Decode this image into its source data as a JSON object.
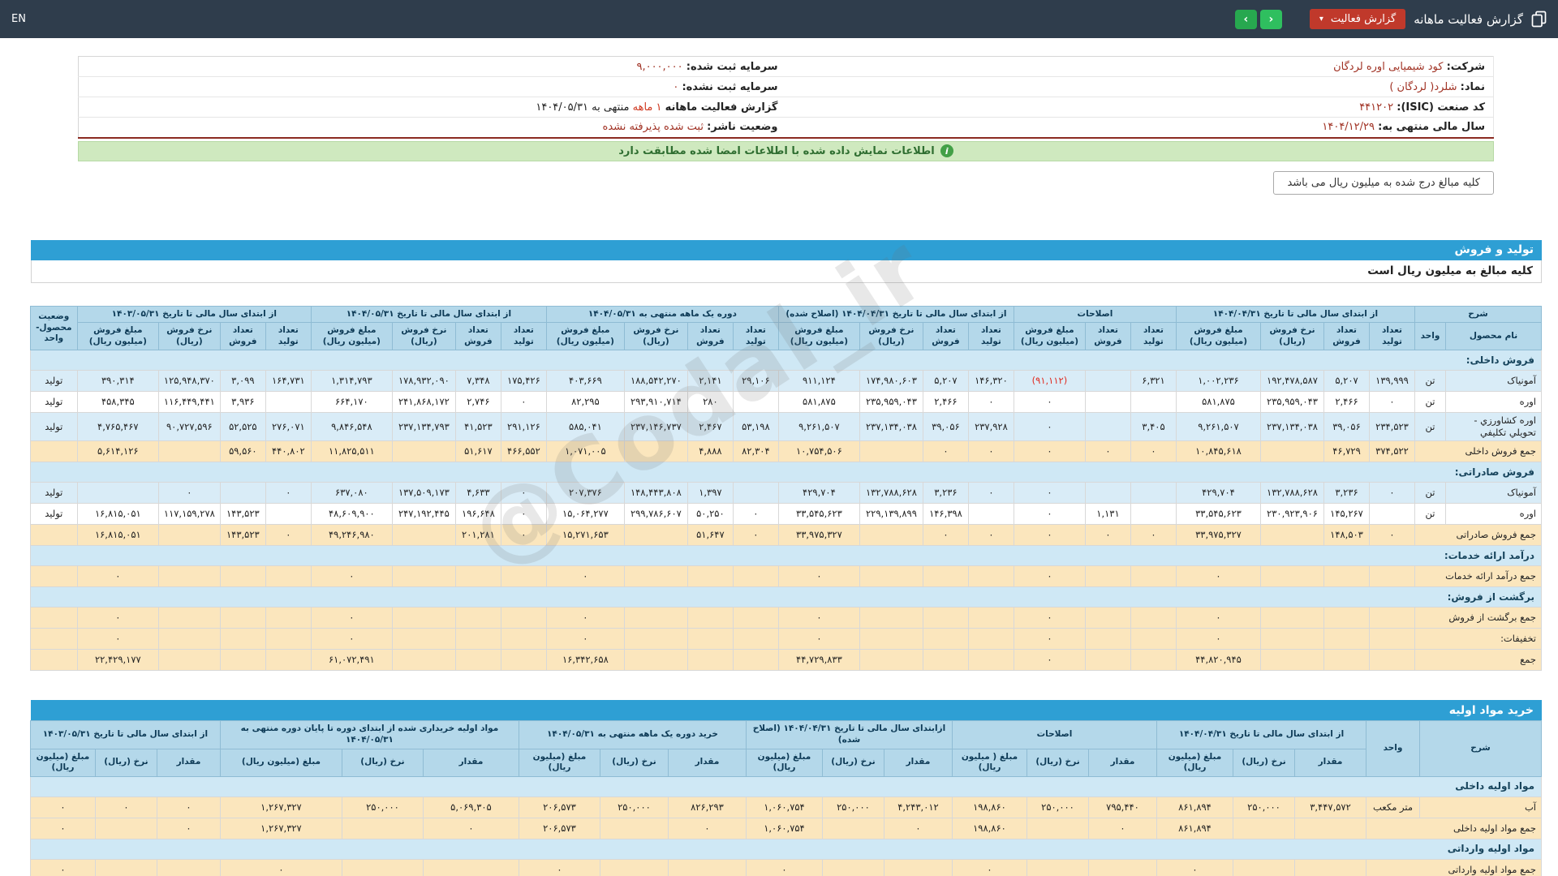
{
  "topbar": {
    "en": "EN",
    "title": "گزارش فعالیت ماهانه",
    "report_button": "گزارش فعالیت",
    "caret": "▾",
    "next": "›",
    "prev": "‹"
  },
  "info": {
    "rows": [
      {
        "r_label": "شرکت:",
        "r_value": "کود شیمیایی اوره لردگان",
        "l_label": "سرمایه ثبت شده:",
        "l_value": "۹,۰۰۰,۰۰۰"
      },
      {
        "r_label": "نماد:",
        "r_value": "شلرد( لردگان )",
        "l_label": "سرمایه ثبت نشده:",
        "l_value": "۰"
      },
      {
        "r_label": "کد صنعت (ISIC):",
        "r_value": "۴۴۱۲۰۲",
        "l_label": "گزارش فعالیت ماهانه",
        "l_red": "۱ ماهه",
        "l_value": "منتهی به ۱۴۰۴/۰۵/۳۱"
      },
      {
        "r_label": "سال مالی منتهی به:",
        "r_value": "۱۴۰۴/۱۲/۲۹",
        "l_label": "وضعیت ناشر:",
        "l_value": "ثبت شده پذیرفته نشده"
      }
    ]
  },
  "notice": "اطلاعات نمایش داده شده با اطلاعات امضا شده مطابقت دارد",
  "unit_tab": "کلیه مبالغ درج شده به میلیون ریال می باشد",
  "section1": {
    "title": "تولید و فروش",
    "subtitle": "کلیه مبالغ به میلیون ریال است"
  },
  "section2": {
    "title": "خرید مواد اولیه"
  },
  "watermark": "@Codal_ir",
  "table1": {
    "desc_header": "شرح",
    "name_col": "نام محصول",
    "unit_col": "واحد",
    "status_header": "وضعیت محصول-واحد",
    "groups": [
      {
        "label": "از ابتدای سال مالی تا تاریخ ۱۴۰۴/۰۴/۳۱",
        "cols": [
          "تعداد تولید",
          "تعداد فروش",
          "نرخ فروش (ریال)",
          "مبلغ فروش (میلیون ریال)"
        ]
      },
      {
        "label": "اصلاحات",
        "cols": [
          "تعداد تولید",
          "تعداد فروش",
          "مبلغ فروش (میلیون ریال)"
        ]
      },
      {
        "label": "از ابتدای سال مالی تا تاریخ ۱۴۰۴/۰۴/۳۱ (اصلاح شده)",
        "cols": [
          "تعداد تولید",
          "تعداد فروش",
          "نرخ فروش (ریال)",
          "مبلغ فروش (میلیون ریال)"
        ]
      },
      {
        "label": "دوره یک ماهه منتهی به ۱۴۰۴/۰۵/۳۱",
        "cols": [
          "تعداد تولید",
          "تعداد فروش",
          "نرخ فروش (ریال)",
          "مبلغ فروش (میلیون ریال)"
        ]
      },
      {
        "label": "از ابتدای سال مالی تا تاریخ ۱۴۰۴/۰۵/۳۱",
        "cols": [
          "تعداد تولید",
          "تعداد فروش",
          "نرخ فروش (ریال)",
          "مبلغ فروش (میلیون ریال)"
        ]
      },
      {
        "label": "از ابتدای سال مالی تا تاریخ ۱۴۰۳/۰۵/۳۱",
        "cols": [
          "تعداد تولید",
          "تعداد فروش",
          "نرخ فروش (ریال)",
          "مبلغ فروش (میلیون ریال)"
        ]
      }
    ],
    "rows": [
      {
        "kind": "section",
        "label": "فروش داخلی:"
      },
      {
        "kind": "data",
        "shade": "blue",
        "label": "آمونیاک",
        "unit": "تن",
        "status": "تولید",
        "c": [
          "۱۳۹,۹۹۹",
          "۵,۲۰۷",
          "۱۹۲,۴۷۸,۵۸۷",
          "۱,۰۰۲,۲۳۶",
          "۶,۳۲۱",
          "",
          "(۹۱,۱۱۲)",
          "۱۴۶,۳۲۰",
          "۵,۲۰۷",
          "۱۷۴,۹۸۰,۶۰۳",
          "۹۱۱,۱۲۴",
          "۲۹,۱۰۶",
          "۲,۱۴۱",
          "۱۸۸,۵۴۲,۲۷۰",
          "۴۰۳,۶۶۹",
          "۱۷۵,۴۲۶",
          "۷,۳۴۸",
          "۱۷۸,۹۳۲,۰۹۰",
          "۱,۳۱۴,۷۹۳",
          "۱۶۴,۷۳۱",
          "۳,۰۹۹",
          "۱۲۵,۹۴۸,۳۷۰",
          "۳۹۰,۳۱۴"
        ]
      },
      {
        "kind": "data",
        "shade": "white",
        "label": "اوره",
        "unit": "تن",
        "status": "تولید",
        "c": [
          "۰",
          "۲,۴۶۶",
          "۲۳۵,۹۵۹,۰۴۳",
          "۵۸۱,۸۷۵",
          "",
          "",
          "۰",
          "۰",
          "۲,۴۶۶",
          "۲۳۵,۹۵۹,۰۴۳",
          "۵۸۱,۸۷۵",
          "",
          "۲۸۰",
          "۲۹۳,۹۱۰,۷۱۴",
          "۸۲,۲۹۵",
          "۰",
          "۲,۷۴۶",
          "۲۴۱,۸۶۸,۱۷۲",
          "۶۶۴,۱۷۰",
          "",
          "۳,۹۳۶",
          "۱۱۶,۴۴۹,۴۴۱",
          "۴۵۸,۳۴۵"
        ]
      },
      {
        "kind": "data",
        "shade": "blue",
        "label": "اوره کشاورزي - تحويلي تکليفي",
        "unit": "تن",
        "status": "تولید",
        "c": [
          "۲۳۴,۵۲۳",
          "۳۹,۰۵۶",
          "۲۳۷,۱۳۴,۰۳۸",
          "۹,۲۶۱,۵۰۷",
          "۳,۴۰۵",
          "",
          "۰",
          "۲۳۷,۹۲۸",
          "۳۹,۰۵۶",
          "۲۳۷,۱۳۴,۰۳۸",
          "۹,۲۶۱,۵۰۷",
          "۵۳,۱۹۸",
          "۲,۴۶۷",
          "۲۳۷,۱۴۶,۷۳۷",
          "۵۸۵,۰۴۱",
          "۲۹۱,۱۲۶",
          "۴۱,۵۲۳",
          "۲۳۷,۱۳۴,۷۹۳",
          "۹,۸۴۶,۵۴۸",
          "۲۷۶,۰۷۱",
          "۵۲,۵۲۵",
          "۹۰,۷۲۷,۵۹۶",
          "۴,۷۶۵,۴۶۷"
        ]
      },
      {
        "kind": "data",
        "shade": "cream",
        "label": "جمع فروش داخلی",
        "unit": null,
        "status": "",
        "c": [
          "۳۷۴,۵۲۲",
          "۴۶,۷۲۹",
          "",
          "۱۰,۸۴۵,۶۱۸",
          "۰",
          "۰",
          "۰",
          "۰",
          "۰",
          "",
          "۱۰,۷۵۴,۵۰۶",
          "۸۲,۳۰۴",
          "۴,۸۸۸",
          "",
          "۱,۰۷۱,۰۰۵",
          "۴۶۶,۵۵۲",
          "۵۱,۶۱۷",
          "",
          "۱۱,۸۲۵,۵۱۱",
          "۴۴۰,۸۰۲",
          "۵۹,۵۶۰",
          "",
          "۵,۶۱۴,۱۲۶"
        ]
      },
      {
        "kind": "section",
        "label": "فروش صادراتی:"
      },
      {
        "kind": "data",
        "shade": "blue",
        "label": "آمونیاک",
        "unit": "تن",
        "status": "تولید",
        "c": [
          "۰",
          "۳,۲۳۶",
          "۱۳۲,۷۸۸,۶۲۸",
          "۴۲۹,۷۰۴",
          "",
          "",
          "۰",
          "۰",
          "۳,۲۳۶",
          "۱۳۲,۷۸۸,۶۲۸",
          "۴۲۹,۷۰۴",
          "",
          "۱,۳۹۷",
          "۱۴۸,۴۴۳,۸۰۸",
          "۲۰۷,۳۷۶",
          "۰",
          "۴,۶۳۳",
          "۱۳۷,۵۰۹,۱۷۳",
          "۶۳۷,۰۸۰",
          "۰",
          "",
          "۰",
          ""
        ]
      },
      {
        "kind": "data",
        "shade": "white",
        "label": "اوره",
        "unit": "تن",
        "status": "تولید",
        "c": [
          "",
          "۱۴۵,۲۶۷",
          "۲۳۰,۹۲۳,۹۰۶",
          "۳۳,۵۴۵,۶۲۳",
          "",
          "۱,۱۳۱",
          "۰",
          "",
          "۱۴۶,۳۹۸",
          "۲۲۹,۱۳۹,۸۹۹",
          "۳۳,۵۴۵,۶۲۳",
          "۰",
          "۵۰,۲۵۰",
          "۲۹۹,۷۸۶,۶۰۷",
          "۱۵,۰۶۴,۲۷۷",
          "۰",
          "۱۹۶,۶۴۸",
          "۲۴۷,۱۹۲,۴۴۵",
          "۴۸,۶۰۹,۹۰۰",
          "",
          "۱۴۳,۵۲۳",
          "۱۱۷,۱۵۹,۲۷۸",
          "۱۶,۸۱۵,۰۵۱"
        ]
      },
      {
        "kind": "data",
        "shade": "cream",
        "label": "جمع فروش صادراتی",
        "unit": null,
        "status": "",
        "c": [
          "۰",
          "۱۴۸,۵۰۳",
          "",
          "۳۳,۹۷۵,۳۲۷",
          "۰",
          "۰",
          "۰",
          "۰",
          "۰",
          "",
          "۳۳,۹۷۵,۳۲۷",
          "۰",
          "۵۱,۶۴۷",
          "",
          "۱۵,۲۷۱,۶۵۳",
          "۰",
          "۲۰۱,۲۸۱",
          "",
          "۴۹,۲۴۶,۹۸۰",
          "۰",
          "۱۴۳,۵۲۳",
          "",
          "۱۶,۸۱۵,۰۵۱"
        ]
      },
      {
        "kind": "section",
        "label": "درآمد ارائه خدمات:"
      },
      {
        "kind": "data",
        "shade": "cream",
        "label": "جمع درآمد ارائه خدمات",
        "unit": null,
        "status": "",
        "c": [
          "",
          "",
          "",
          "۰",
          "",
          "",
          "۰",
          "",
          "",
          "",
          "۰",
          "",
          "",
          "",
          "۰",
          "",
          "",
          "",
          "۰",
          "",
          "",
          "",
          "۰"
        ]
      },
      {
        "kind": "section",
        "label": "برگشت از فروش:"
      },
      {
        "kind": "data",
        "shade": "cream",
        "label": "جمع برگشت از فروش",
        "unit": null,
        "status": "",
        "c": [
          "",
          "",
          "",
          "۰",
          "",
          "",
          "۰",
          "",
          "",
          "",
          "۰",
          "",
          "",
          "",
          "۰",
          "",
          "",
          "",
          "۰",
          "",
          "",
          "",
          "۰"
        ]
      },
      {
        "kind": "data",
        "shade": "cream",
        "label": "تخفیفات:",
        "unit": null,
        "status": "",
        "c": [
          "",
          "",
          "",
          "۰",
          "",
          "",
          "۰",
          "",
          "",
          "",
          "۰",
          "",
          "",
          "",
          "۰",
          "",
          "",
          "",
          "۰",
          "",
          "",
          "",
          "۰"
        ]
      },
      {
        "kind": "data",
        "shade": "cream",
        "label": "جمع",
        "unit": null,
        "status": "",
        "c": [
          "",
          "",
          "",
          "۴۴,۸۲۰,۹۴۵",
          "",
          "",
          "۰",
          "",
          "",
          "",
          "۴۴,۷۲۹,۸۳۳",
          "",
          "",
          "",
          "۱۶,۳۴۲,۶۵۸",
          "",
          "",
          "",
          "۶۱,۰۷۲,۴۹۱",
          "",
          "",
          "",
          "۲۲,۴۲۹,۱۷۷"
        ]
      }
    ]
  },
  "table2": {
    "desc_header": "شرح",
    "unit_col": "واحد",
    "groups": [
      {
        "label": "از ابتدای سال مالی تا تاریخ ۱۴۰۴/۰۴/۳۱",
        "cols": [
          "مقدار",
          "نرخ (ریال)",
          "مبلغ (میلیون ریال)"
        ]
      },
      {
        "label": "اصلاحات",
        "cols": [
          "مقدار",
          "نرخ (ریال)",
          "مبلغ ( میلیون ریال)"
        ]
      },
      {
        "label": "ازابتدای سال مالی تا تاریخ ۱۴۰۴/۰۴/۳۱ (اصلاح شده)",
        "cols": [
          "مقدار",
          "نرخ (ریال)",
          "مبلغ (میلیون ریال)"
        ]
      },
      {
        "label": "خرید دوره یک ماهه منتهی به ۱۴۰۴/۰۵/۳۱",
        "cols": [
          "مقدار",
          "نرخ (ریال)",
          "مبلغ (میلیون ریال)"
        ]
      },
      {
        "label": "مواد اولیه خریداری شده از ابتدای دوره تا پایان دوره منتهی به ۱۴۰۴/۰۵/۳۱",
        "cols": [
          "مقدار",
          "نرخ (ریال)",
          "مبلغ (میلیون ریال)"
        ]
      },
      {
        "label": "از ابتدای سال مالی تا تاریخ ۱۴۰۳/۰۵/۳۱",
        "cols": [
          "مقدار",
          "نرخ (ریال)",
          "مبلغ (میلیون ریال)"
        ]
      }
    ],
    "rows": [
      {
        "kind": "section",
        "label": "مواد اولیه داخلی"
      },
      {
        "kind": "data",
        "shade": "cream",
        "label": "آب",
        "unit": "متر مکعب",
        "c": [
          "۳,۴۴۷,۵۷۲",
          "۲۵۰,۰۰۰",
          "۸۶۱,۸۹۴",
          "۷۹۵,۴۴۰",
          "۲۵۰,۰۰۰",
          "۱۹۸,۸۶۰",
          "۴,۲۴۳,۰۱۲",
          "۲۵۰,۰۰۰",
          "۱,۰۶۰,۷۵۴",
          "۸۲۶,۲۹۳",
          "۲۵۰,۰۰۰",
          "۲۰۶,۵۷۳",
          "۵,۰۶۹,۳۰۵",
          "۲۵۰,۰۰۰",
          "۱,۲۶۷,۳۲۷",
          "۰",
          "۰",
          "۰"
        ]
      },
      {
        "kind": "data",
        "shade": "cream",
        "label": "جمع مواد اولیه داخلی",
        "unit": null,
        "c": [
          "",
          "",
          "۸۶۱,۸۹۴",
          "۰",
          "",
          "۱۹۸,۸۶۰",
          "۰",
          "",
          "۱,۰۶۰,۷۵۴",
          "۰",
          "",
          "۲۰۶,۵۷۳",
          "۰",
          "",
          "۱,۲۶۷,۳۲۷",
          "۰",
          "",
          "۰"
        ]
      },
      {
        "kind": "section",
        "label": "مواد اولیه وارداتی"
      },
      {
        "kind": "data",
        "shade": "cream",
        "label": "جمع مواد اولیه وارداتی",
        "unit": null,
        "c": [
          "",
          "",
          "۰",
          "",
          "",
          "۰",
          "",
          "",
          "۰",
          "",
          "",
          "۰",
          "",
          "",
          "۰",
          "",
          "",
          "۰"
        ]
      }
    ]
  }
}
